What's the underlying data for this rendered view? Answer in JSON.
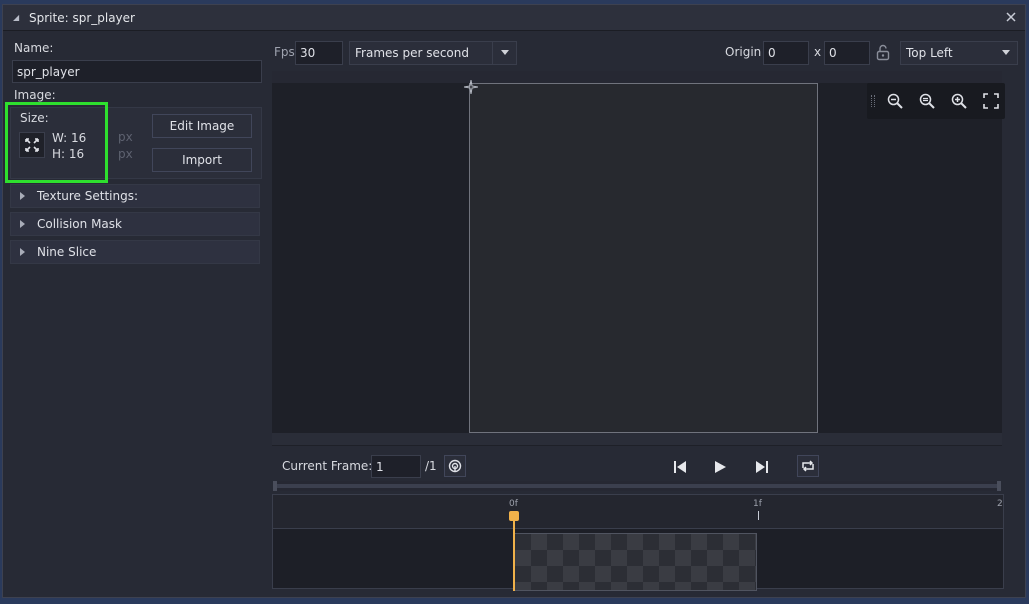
{
  "window": {
    "title": "Sprite: spr_player"
  },
  "left": {
    "name_label": "Name:",
    "name_value": "spr_player",
    "image_label": "Image:",
    "size_label": "Size:",
    "width_text": "W: 16",
    "height_text": "H: 16",
    "unit_px": "px",
    "edit_image_label": "Edit Image",
    "import_label": "Import",
    "sections": [
      "Texture Settings:",
      "Collision Mask",
      "Nine Slice"
    ]
  },
  "toolbar": {
    "fps_label": "Fps",
    "fps_value": "30",
    "fps_mode": "Frames per second",
    "origin_label": "Origin",
    "origin_x": "0",
    "origin_sep": "x",
    "origin_y": "0",
    "origin_preset": "Top Left"
  },
  "playback": {
    "current_frame_label": "Current Frame:",
    "current_frame_value": "1",
    "total_frames": "/1"
  },
  "timeline": {
    "ticks": [
      "0f",
      "1f",
      "2"
    ]
  },
  "icons": {
    "collapse": "triangle-down-icon",
    "close": "close-icon",
    "resize": "resize-icon",
    "lock": "lock-open-icon",
    "origin_marker": "crosshair-icon",
    "zoom_out": "zoom-out-icon",
    "zoom_reset": "zoom-reset-icon",
    "zoom_in": "zoom-in-icon",
    "fit": "fit-screen-icon",
    "onion": "onion-skin-icon",
    "first": "skip-start-icon",
    "play": "play-icon",
    "last": "skip-end-icon",
    "loop": "loop-icon"
  },
  "colors": {
    "accent": "#f0b14a",
    "highlight": "#2ee02e"
  }
}
